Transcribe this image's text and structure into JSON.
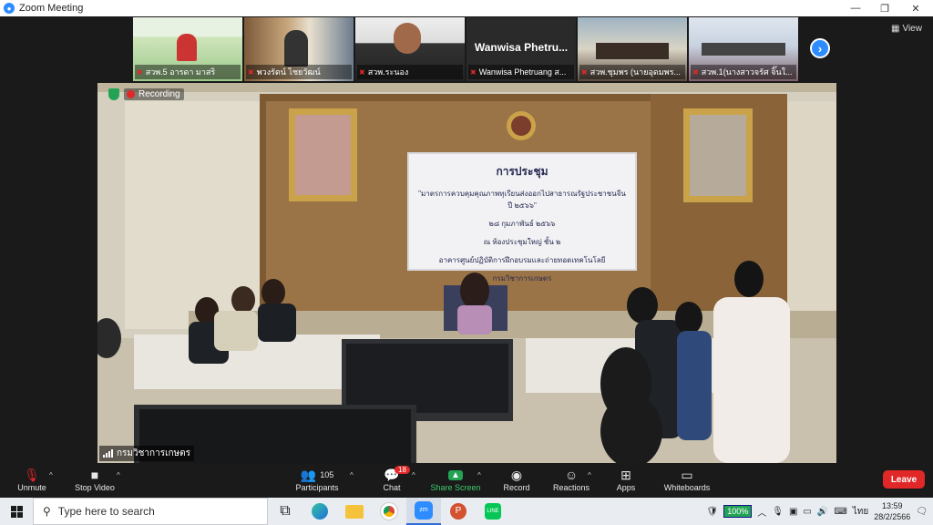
{
  "window": {
    "title": "Zoom Meeting"
  },
  "participants_strip": [
    {
      "name": "สวพ.5 อารดา มาสริ"
    },
    {
      "name": "พวงรัตน์ ไชยวัฒน์"
    },
    {
      "name": "สวพ.ระนอง"
    },
    {
      "name": "Wanwisa Phetruang ส...",
      "big_label": "Wanwisa Phetru..."
    },
    {
      "name": "สวพ.ชุมพร (นายอุดมพร..."
    },
    {
      "name": "สวพ.1(นางสาวจรัศ จิ๊นใ..."
    }
  ],
  "view_button": {
    "label": "View"
  },
  "recording": {
    "label": "Recording"
  },
  "active_speaker": {
    "name": "กรมวิชาการเกษตร"
  },
  "room_screen": {
    "title": "การประชุม",
    "lines": [
      "\"มาตรการควบคุมคุณภาพทุเรียนส่งออกไปสาธารณรัฐประชาชนจีน ปี ๒๕๖๖\"",
      "๒๘ กุมภาพันธ์ ๒๕๖๖",
      "ณ ห้องประชุมใหญ่ ชั้น ๒",
      "อาคารศูนย์ปฏิบัติการฝึกอบรมและถ่ายทอดเทคโนโลยี",
      "กรมวิชาการเกษตร"
    ]
  },
  "toolbar": {
    "unmute": "Unmute",
    "stop_video": "Stop Video",
    "participants": "Participants",
    "participants_count": "105",
    "chat": "Chat",
    "chat_badge": "18",
    "share_screen": "Share Screen",
    "record": "Record",
    "reactions": "Reactions",
    "apps": "Apps",
    "whiteboards": "Whiteboards",
    "leave": "Leave"
  },
  "taskbar": {
    "search_placeholder": "Type here to search",
    "battery": "100%",
    "language": "ไทย",
    "time": "13:59",
    "date": "28/2/2566"
  },
  "colors": {
    "accent": "#2d8cff",
    "leave": "#e02828",
    "share": "#23a455"
  }
}
